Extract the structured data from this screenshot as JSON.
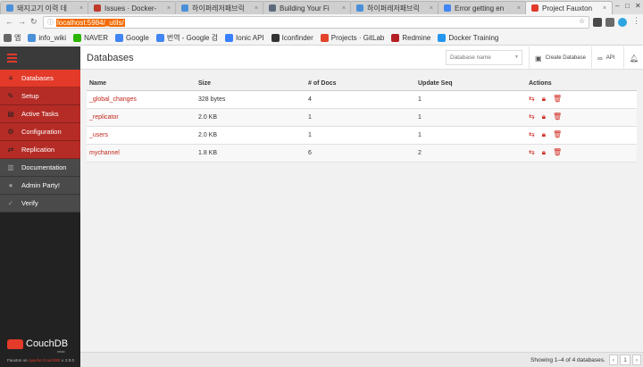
{
  "browser": {
    "tabs": [
      {
        "label": "돼지고기 이력 데",
        "color": "#4a90d9"
      },
      {
        "label": "Issues · Docker-",
        "color": "#c0392b"
      },
      {
        "label": "하이퍼레저패브릭",
        "color": "#4a90d9"
      },
      {
        "label": "Building Your Fi",
        "color": "#5c6b7a"
      },
      {
        "label": "하이퍼레저패브릭",
        "color": "#4a90d9"
      },
      {
        "label": "Error getting en",
        "color": "#4285f4"
      },
      {
        "label": "Project Fauxton",
        "color": "#e33a2a"
      }
    ],
    "tab_close": "×",
    "win_controls": [
      "–",
      "□",
      "✕"
    ],
    "url": "localhost:5984/_utils/"
  },
  "bookmarks": [
    {
      "label": "앱",
      "color": "#555"
    },
    {
      "label": "info_wiki",
      "color": "#4a90d9"
    },
    {
      "label": "NAVER",
      "color": "#2db400"
    },
    {
      "label": "Google",
      "color": "#4285f4"
    },
    {
      "label": "번역 - Google 검",
      "color": "#4285f4"
    },
    {
      "label": "Ionic API",
      "color": "#3880ff"
    },
    {
      "label": "Iconfinder",
      "color": "#333333"
    },
    {
      "label": "Projects · GitLab",
      "color": "#e24329"
    },
    {
      "label": "Redmine",
      "color": "#b32024"
    },
    {
      "label": "Docker Training",
      "color": "#2496ed"
    }
  ],
  "sidebar": {
    "items": [
      {
        "label": "Databases",
        "style": "active",
        "icon": "database-icon",
        "glyph": "≡"
      },
      {
        "label": "Setup",
        "style": "red",
        "icon": "wrench-icon",
        "glyph": "✎"
      },
      {
        "label": "Active Tasks",
        "style": "red",
        "icon": "tasks-icon",
        "glyph": "▤"
      },
      {
        "label": "Configuration",
        "style": "red",
        "icon": "gear-icon",
        "glyph": "⚙"
      },
      {
        "label": "Replication",
        "style": "red",
        "icon": "replication-icon",
        "glyph": "⇄"
      },
      {
        "label": "Documentation",
        "style": "dark",
        "icon": "book-icon",
        "glyph": "▥"
      },
      {
        "label": "Admin Party!",
        "style": "dark",
        "icon": "user-icon",
        "glyph": "●"
      },
      {
        "label": "Verify",
        "style": "dark",
        "icon": "check-icon",
        "glyph": "✓"
      }
    ],
    "logo": "CouchDB",
    "logo_sub": "relax",
    "footer_prefix": "Fauxton on ",
    "footer_link": "Apache CouchDB",
    "footer_version": " v. 2.0.0"
  },
  "header": {
    "title": "Databases",
    "search_placeholder": "Database name",
    "create_label": "Create Database",
    "api_label": "API"
  },
  "table": {
    "columns": [
      "Name",
      "Size",
      "# of Docs",
      "Update Seq",
      "Actions"
    ],
    "rows": [
      {
        "name": "_global_changes",
        "size": "328 bytes",
        "docs": "4",
        "seq": "1"
      },
      {
        "name": "_replicator",
        "size": "2.0 KB",
        "docs": "1",
        "seq": "1"
      },
      {
        "name": "_users",
        "size": "2.0 KB",
        "docs": "1",
        "seq": "1"
      },
      {
        "name": "mychannel",
        "size": "1.8 KB",
        "docs": "6",
        "seq": "2"
      }
    ]
  },
  "footer": {
    "showing": "Showing 1–4 of 4 databases.",
    "prev": "‹",
    "page": "1",
    "next": "›"
  }
}
